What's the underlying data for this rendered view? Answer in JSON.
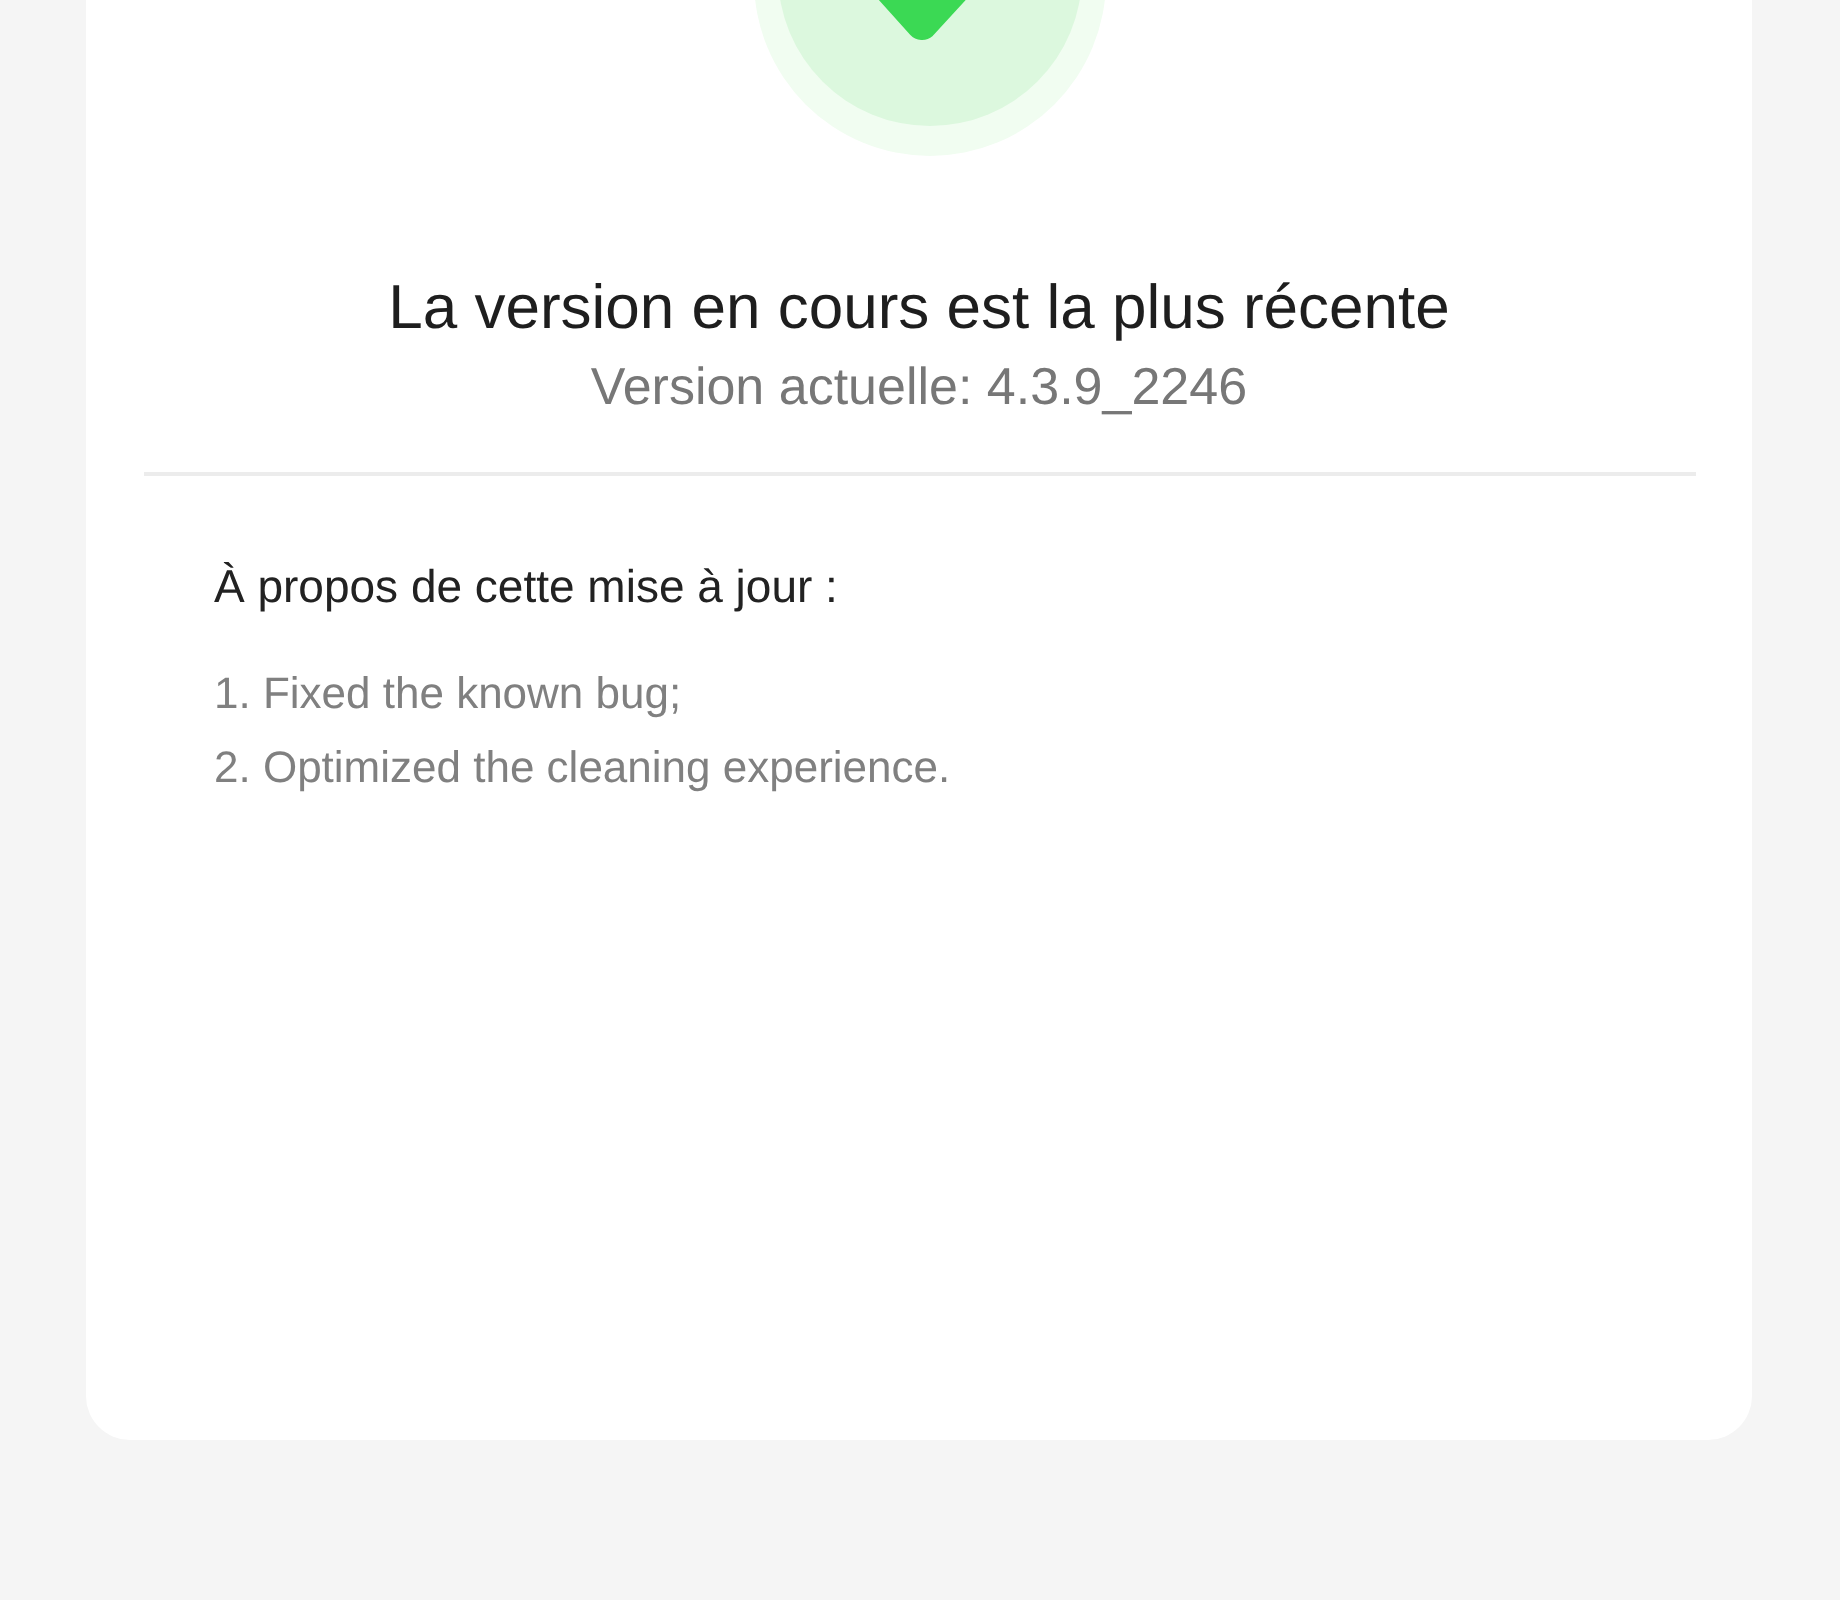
{
  "status": {
    "title": "La version en cours est la plus récente",
    "version": "Version actuelle: 4.3.9_2246"
  },
  "notes": {
    "heading": "À propos de cette mise à jour :",
    "items": [
      "1. Fixed the known bug;",
      "2. Optimized the cleaning experience."
    ]
  }
}
